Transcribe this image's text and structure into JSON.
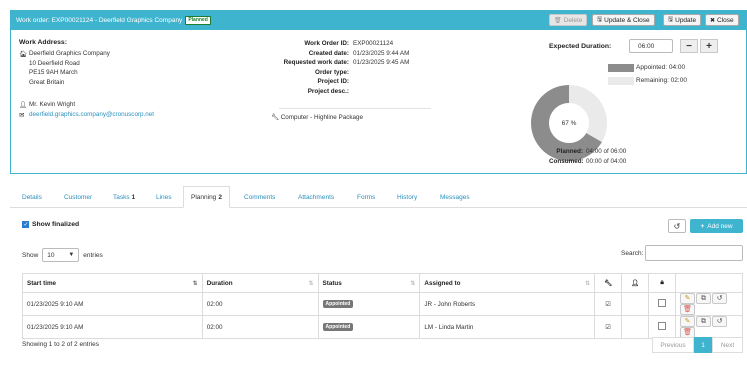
{
  "header": {
    "title": "Work order: EXP00021124 - Deerfield Graphics Company",
    "status_badge": "Planned",
    "buttons": {
      "delete": "Delete",
      "update_close": "Update & Close",
      "update": "Update",
      "close": "Close"
    }
  },
  "work_address": {
    "label": "Work Address:",
    "lines": [
      "Deerfield Graphics Company",
      "10 Deerfield Road",
      "PE15 9AH March",
      "Great Britain"
    ],
    "contact": "Mr. Kevin Wright",
    "email": "deerfield.graphics.company@cronuscorp.net"
  },
  "info": [
    {
      "label": "Work Order ID:",
      "value": "EXP00021124"
    },
    {
      "label": "Created date:",
      "value": "01/23/2025 9:44 AM"
    },
    {
      "label": "Requested work date:",
      "value": "01/23/2025 9:45 AM"
    },
    {
      "label": "Order type:",
      "value": ""
    },
    {
      "label": "Project ID:",
      "value": ""
    },
    {
      "label": "Project desc.:",
      "value": ""
    }
  ],
  "package": "Computer - Highline Package",
  "duration": {
    "label": "Expected Duration:",
    "value": "06:00",
    "minus": "−",
    "plus": "+"
  },
  "chart_data": {
    "type": "pie",
    "center_label": "67 %",
    "slices": [
      {
        "name": "Appointed: 04:00",
        "value": 4,
        "color": "#8c8c8c"
      },
      {
        "name": "Remaining: 02:00",
        "value": 2,
        "color": "#eaeaea"
      }
    ]
  },
  "summary": {
    "planned_label": "Planned:",
    "planned_value": "04:00 of 06:00",
    "consumed_label": "Consumed:",
    "consumed_value": "00:00 of 04:00"
  },
  "tabs": [
    {
      "label": "Details",
      "count": ""
    },
    {
      "label": "Customer",
      "count": ""
    },
    {
      "label": "Tasks",
      "count": "1"
    },
    {
      "label": "Lines",
      "count": ""
    },
    {
      "label": "Planning",
      "count": "2"
    },
    {
      "label": "Comments",
      "count": ""
    },
    {
      "label": "Attachments",
      "count": ""
    },
    {
      "label": "Forms",
      "count": ""
    },
    {
      "label": "History",
      "count": ""
    },
    {
      "label": "Messages",
      "count": ""
    }
  ],
  "planning": {
    "show_finalized": "Show finalized",
    "add_new": "Add new",
    "show_label": "Show",
    "entries_value": "10",
    "entries_label": "entries",
    "search_label": "Search:",
    "columns": [
      "Start time",
      "Duration",
      "Status",
      "Assigned to"
    ],
    "rows": [
      {
        "start": "01/23/2025 9:10 AM",
        "duration": "02:00",
        "status": "Appointed",
        "assigned": "JR - John Roberts"
      },
      {
        "start": "01/23/2025 9:10 AM",
        "duration": "02:00",
        "status": "Appointed",
        "assigned": "LM - Linda Martin"
      }
    ],
    "footer": "Showing 1 to 2 of 2 entries",
    "pagination": {
      "previous": "Previous",
      "page": "1",
      "next": "Next"
    }
  }
}
